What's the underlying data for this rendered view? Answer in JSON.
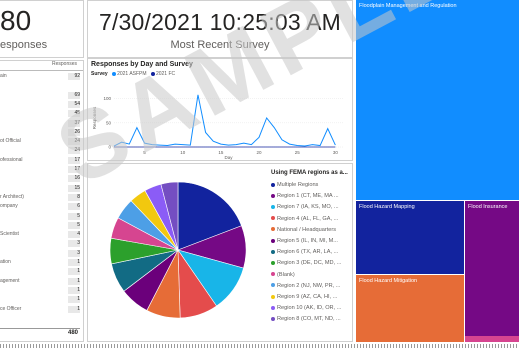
{
  "kpi_responses": {
    "value": "80",
    "caption": "esponses"
  },
  "kpi_latest": {
    "value": "7/30/2021 10:25:03 AM",
    "caption": "Most Recent Survey"
  },
  "table": {
    "header": "Responses",
    "rows": [
      {
        "label": "ain",
        "value": "92"
      },
      {
        "label": "",
        "value": ""
      },
      {
        "label": "",
        "value": "69"
      },
      {
        "label": "",
        "value": "54"
      },
      {
        "label": "",
        "value": "45"
      },
      {
        "label": "",
        "value": "37"
      },
      {
        "label": "",
        "value": "26"
      },
      {
        "label": "ot Official",
        "value": "24"
      },
      {
        "label": "",
        "value": "24"
      },
      {
        "label": "ofessional",
        "value": "17"
      },
      {
        "label": "",
        "value": "17"
      },
      {
        "label": "",
        "value": "16"
      },
      {
        "label": "",
        "value": "15"
      },
      {
        "label": "r Architect)",
        "value": "8"
      },
      {
        "label": "ompany",
        "value": "6"
      },
      {
        "label": "",
        "value": "5"
      },
      {
        "label": "",
        "value": "5"
      },
      {
        "label": "Scientist",
        "value": "4"
      },
      {
        "label": "",
        "value": "3"
      },
      {
        "label": "",
        "value": "3"
      },
      {
        "label": "ation",
        "value": "1"
      },
      {
        "label": "",
        "value": "1"
      },
      {
        "label": "agement",
        "value": "1"
      },
      {
        "label": "",
        "value": "1"
      },
      {
        "label": "",
        "value": "1"
      },
      {
        "label": "ce Officer",
        "value": "1"
      }
    ],
    "total": "480"
  },
  "linechart": {
    "title": "Responses by Day and Survey",
    "legend_label": "Survey",
    "legend_items": [
      {
        "name": "2021 ASFPM",
        "color": "#118dff"
      },
      {
        "name": "2021 FC",
        "color": "#12239e"
      }
    ]
  },
  "chart_data": [
    {
      "type": "line",
      "title": "Responses by Day and Survey",
      "xlabel": "Day",
      "ylabel": "Responses",
      "x_ticks": [
        "5",
        "10",
        "15",
        "20",
        "25",
        "30"
      ],
      "y_ticks": [
        "0",
        "50",
        "100"
      ],
      "xlim": [
        1,
        31
      ],
      "ylim": [
        0,
        120
      ],
      "series": [
        {
          "name": "2021 ASFPM",
          "color": "#118dff",
          "x": [
            1,
            2,
            3,
            4,
            5,
            6,
            7,
            8,
            9,
            10,
            11,
            12,
            13,
            14,
            15,
            16,
            17,
            18,
            19,
            20,
            21,
            22,
            23,
            24,
            25,
            26,
            27,
            28,
            29,
            30
          ],
          "values": [
            2,
            10,
            6,
            40,
            8,
            5,
            4,
            3,
            6,
            5,
            4,
            108,
            30,
            12,
            6,
            4,
            5,
            8,
            5,
            20,
            60,
            40,
            15,
            6,
            3,
            2,
            5,
            3,
            38,
            4
          ]
        },
        {
          "name": "2021 FC",
          "color": "#12239e",
          "x": [
            1,
            2,
            3,
            4,
            5,
            6,
            7,
            8,
            9,
            10,
            11,
            12,
            13,
            14,
            15,
            16,
            17,
            18,
            19,
            20,
            21,
            22,
            23,
            24,
            25,
            26,
            27,
            28,
            29,
            30
          ],
          "values": [
            0,
            0,
            0,
            0,
            0,
            0,
            0,
            0,
            0,
            0,
            0,
            0,
            0,
            0,
            0,
            0,
            0,
            0,
            0,
            0,
            0,
            0,
            0,
            0,
            0,
            0,
            0,
            0,
            0,
            0
          ]
        }
      ]
    },
    {
      "type": "pie",
      "title": "Using FEMA regions as a...",
      "categories": [
        "Multiple Regions",
        "Region 1 (CT, ME, MA ...",
        "Region 7 (IA, KS, MO, ...",
        "Region 4 (AL, FL, GA, ...",
        "National / Headquarters",
        "Region 5 (IL, IN, MI, M...",
        "Region 6 (TX, AR, LA, ...",
        "Region 3 (DE, DC, MD, ...",
        "(Blank)",
        "Region 2 (NJ, NW, PR, ...",
        "Region 9 (AZ, CA, HI, ...",
        "Region 10 (AK, ID, OR, ...",
        "Region 8 (CO, MT, ND, ..."
      ],
      "values": [
        19,
        10,
        11,
        9,
        8,
        7,
        7,
        6,
        5,
        5,
        4,
        4,
        4
      ],
      "colors": [
        "#12239e",
        "#750985",
        "#18b5e8",
        "#e44c4c",
        "#e66c37",
        "#6b007b",
        "#126b84",
        "#2ca02c",
        "#d64590",
        "#4d9fe6",
        "#f2c80f",
        "#8b5cf6",
        "#744ec2"
      ]
    },
    {
      "type": "treemap",
      "categories": [
        "Floodplain Management and Regulation",
        "Flood Hazard Mapping",
        "Flood Insurance",
        "Flood Hazard Mitigation"
      ],
      "colors": [
        "#118dff",
        "#12239e",
        "#750985",
        "#e66c37"
      ]
    }
  ],
  "pie_legend": {
    "title": "Using FEMA regions as a..."
  },
  "watermark": "SAMPLE"
}
